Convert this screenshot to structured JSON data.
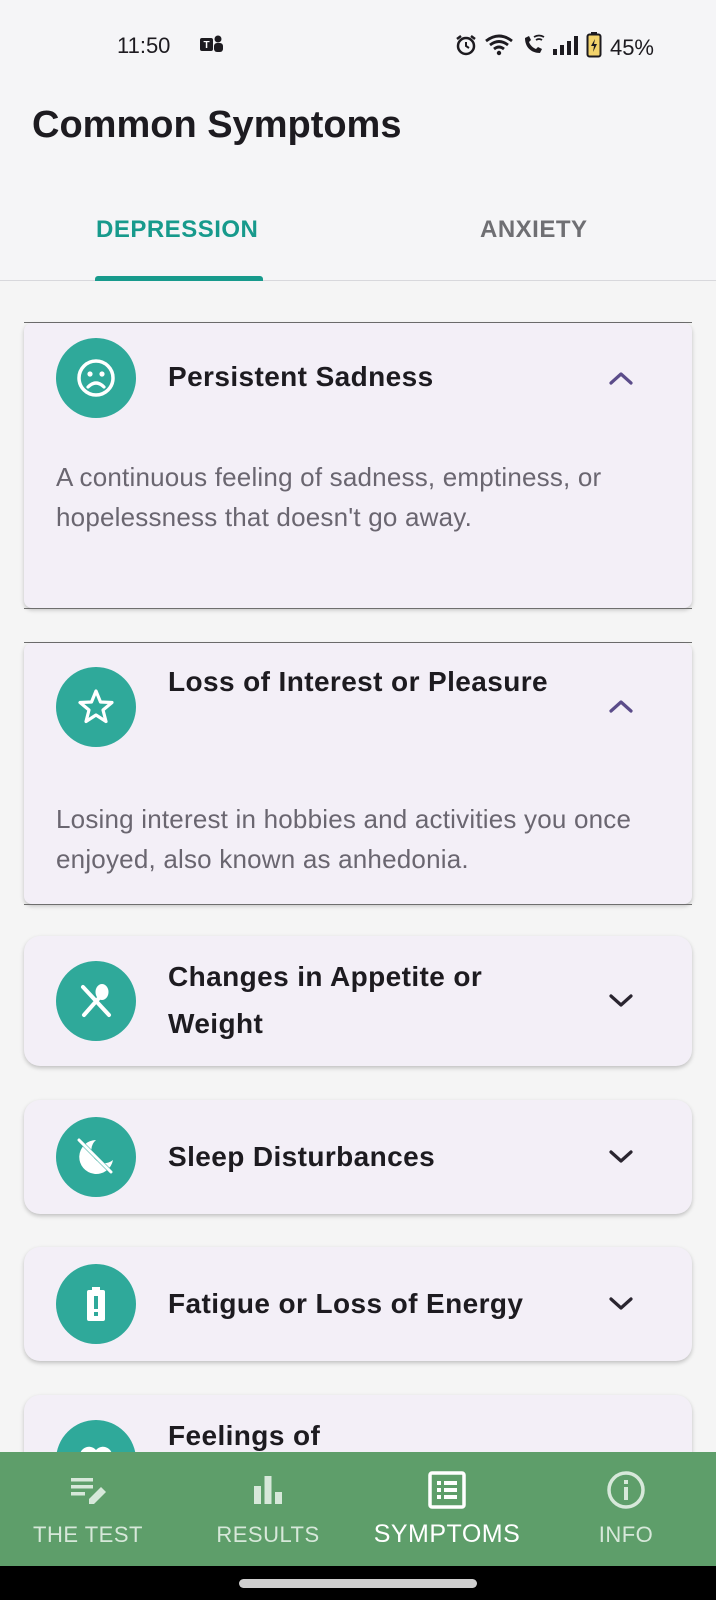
{
  "status_bar": {
    "time": "11:50",
    "battery": "45%"
  },
  "header": {
    "title": "Common Symptoms"
  },
  "tabs": [
    {
      "label": "DEPRESSION",
      "active": true
    },
    {
      "label": "ANXIETY",
      "active": false
    }
  ],
  "symptoms": [
    {
      "icon": "sad-face-icon",
      "title": "Persistent Sadness",
      "expanded": true,
      "description": "A continuous feeling of sadness, emptiness, or hopelessness that doesn't go away."
    },
    {
      "icon": "star-outline-icon",
      "title": "Loss of Interest or Pleasure",
      "expanded": true,
      "description": "Losing interest in hobbies and activities you once enjoyed, also known as anhedonia."
    },
    {
      "icon": "no-meals-icon",
      "title": "Changes in Appetite or Weight",
      "expanded": false
    },
    {
      "icon": "bedtime-off-icon",
      "title": "Sleep Disturbances",
      "expanded": false
    },
    {
      "icon": "battery-alert-icon",
      "title": "Fatigue or Loss of Energy",
      "expanded": false
    },
    {
      "icon": "heart-broken-icon",
      "title": "Feelings of",
      "expanded": false
    }
  ],
  "bottom_nav": [
    {
      "label": "THE TEST",
      "icon": "edit-note-icon",
      "active": false
    },
    {
      "label": "RESULTS",
      "icon": "bar-chart-icon",
      "active": false
    },
    {
      "label": "SYMPTOMS",
      "icon": "list-alt-icon",
      "active": true
    },
    {
      "label": "INFO",
      "icon": "info-icon",
      "active": false
    }
  ],
  "colors": {
    "accent": "#179a8c",
    "icon_bg": "#2fa99a",
    "card_bg": "#f3eff7",
    "nav_bg": "#5e9e6a",
    "chevron": "#5b4c8a"
  }
}
